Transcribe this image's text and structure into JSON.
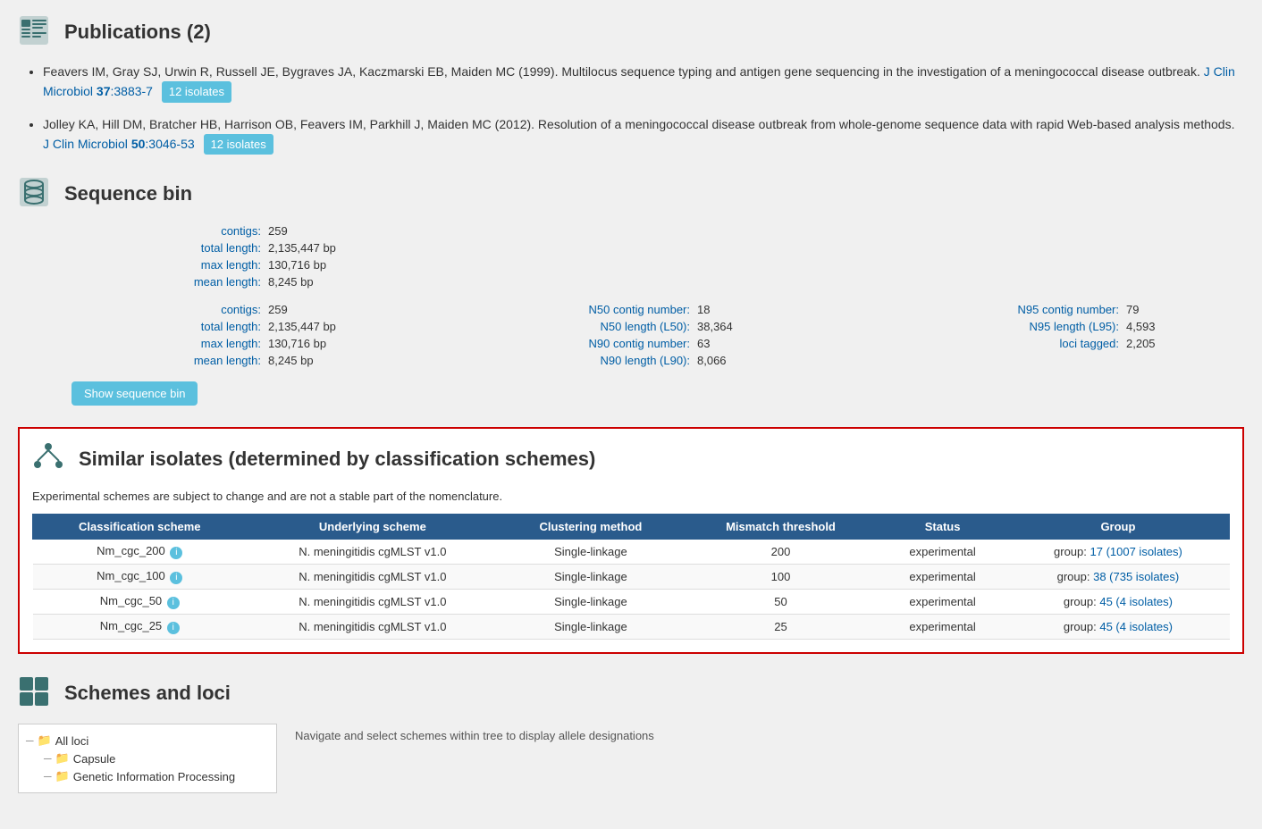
{
  "publications": {
    "title": "Publications (2)",
    "items": [
      {
        "authors": "Feavers IM, Gray SJ, Urwin R, Russell JE, Bygraves JA, Kaczmarski EB, Maiden MC (1999). Multilocus sequence typing and antigen gene sequencing in the investigation of a meningococcal disease outbreak.",
        "journal_text": "J Clin Microbiol",
        "volume_pages": "37",
        "pages": ":3883-7",
        "badge": "12 isolates"
      },
      {
        "authors": "Jolley KA, Hill DM, Bratcher HB, Harrison OB, Feavers IM, Parkhill J, Maiden MC (2012). Resolution of a meningococcal disease outbreak from whole-genome sequence data with rapid Web-based analysis methods.",
        "journal_text": "J Clin Microbiol",
        "volume_pages": "50",
        "pages": ":3046-53",
        "badge": "12 isolates"
      }
    ]
  },
  "sequence_bin": {
    "title": "Sequence bin",
    "stats": {
      "contigs_label": "contigs:",
      "contigs_value": "259",
      "total_length_label": "total length:",
      "total_length_value": "2,135,447 bp",
      "max_length_label": "max length:",
      "max_length_value": "130,716 bp",
      "mean_length_label": "mean length:",
      "mean_length_value": "8,245 bp",
      "n50_contig_label": "N50 contig number:",
      "n50_contig_value": "18",
      "n50_length_label": "N50 length (L50):",
      "n50_length_value": "38,364",
      "n90_contig_label": "N90 contig number:",
      "n90_contig_value": "63",
      "n90_length_label": "N90 length (L90):",
      "n90_length_value": "8,066",
      "n95_contig_label": "N95 contig number:",
      "n95_contig_value": "79",
      "n95_length_label": "N95 length (L95):",
      "n95_length_value": "4,593",
      "loci_tagged_label": "loci tagged:",
      "loci_tagged_value": "2,205"
    },
    "show_button": "Show sequence bin"
  },
  "similar_isolates": {
    "title": "Similar isolates (determined by classification schemes)",
    "note": "Experimental schemes are subject to change and are not a stable part of the nomenclature.",
    "table": {
      "headers": [
        "Classification scheme",
        "Underlying scheme",
        "Clustering method",
        "Mismatch threshold",
        "Status",
        "Group"
      ],
      "rows": [
        {
          "scheme": "Nm_cgc_200",
          "underlying": "N. meningitidis cgMLST v1.0",
          "clustering": "Single-linkage",
          "threshold": "200",
          "status": "experimental",
          "group_text": "group: ",
          "group_link": "17 (1007 isolates)"
        },
        {
          "scheme": "Nm_cgc_100",
          "underlying": "N. meningitidis cgMLST v1.0",
          "clustering": "Single-linkage",
          "threshold": "100",
          "status": "experimental",
          "group_text": "group: ",
          "group_link": "38 (735 isolates)"
        },
        {
          "scheme": "Nm_cgc_50",
          "underlying": "N. meningitidis cgMLST v1.0",
          "clustering": "Single-linkage",
          "threshold": "50",
          "status": "experimental",
          "group_text": "group: ",
          "group_link": "45 (4 isolates)"
        },
        {
          "scheme": "Nm_cgc_25",
          "underlying": "N. meningitidis cgMLST v1.0",
          "clustering": "Single-linkage",
          "threshold": "25",
          "status": "experimental",
          "group_text": "group: ",
          "group_link": "45 (4 isolates)"
        }
      ]
    }
  },
  "schemes_loci": {
    "title": "Schemes and loci",
    "nav_instructions": "Navigate and select schemes within tree to display allele designations",
    "tree": {
      "items": [
        {
          "label": "All loci",
          "level": 0
        },
        {
          "label": "Capsule",
          "level": 1
        },
        {
          "label": "Genetic Information Processing",
          "level": 1
        }
      ]
    }
  }
}
